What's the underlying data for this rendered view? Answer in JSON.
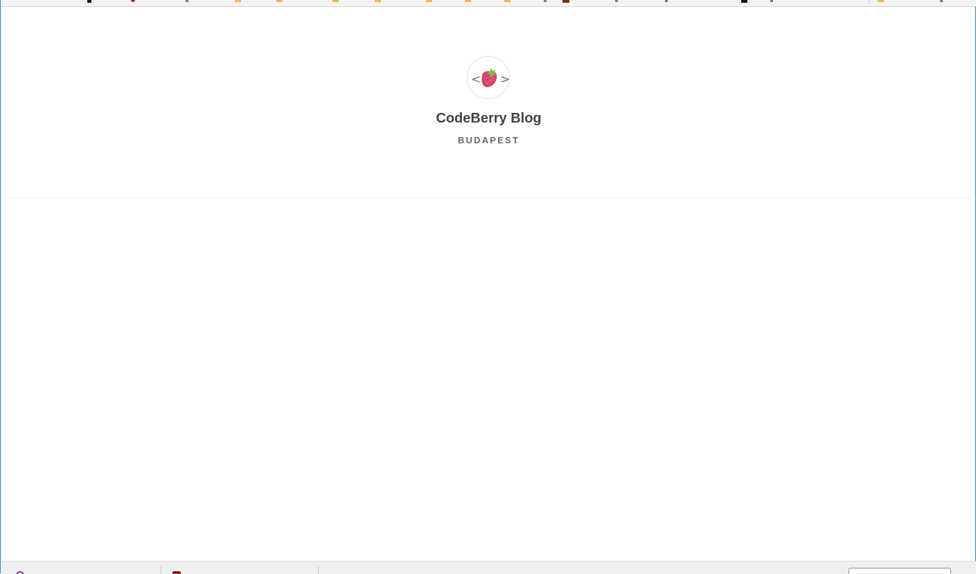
{
  "blog": {
    "title": "CodeBerry Blog",
    "location": "BUDAPEST",
    "logo_icon": "codeberry-strawberry-logo-icon"
  },
  "colors": {
    "berry": "#d2476b",
    "leaf": "#7cc142",
    "text_dark": "#444444",
    "text_muted": "#666666",
    "frame_accent": "#2b7bd6"
  }
}
